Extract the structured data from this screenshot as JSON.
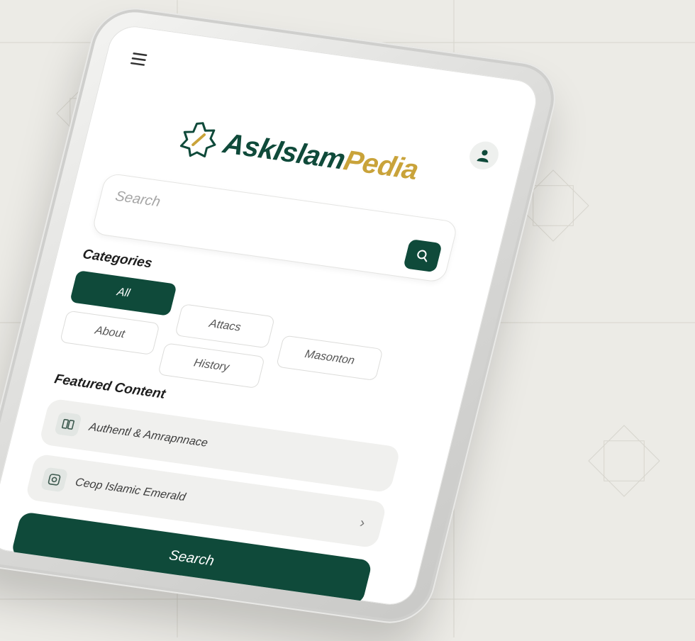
{
  "app": {
    "brand_part1": "AskIslam",
    "brand_part2": "Pedia"
  },
  "search": {
    "placeholder": "Search",
    "button_icon": "search-icon"
  },
  "categories": {
    "title": "Categories",
    "items": [
      {
        "label": "All",
        "active": true
      },
      {
        "label": "Attacs",
        "active": false
      },
      {
        "label": "Masonton",
        "active": false
      },
      {
        "label": "About",
        "active": false
      },
      {
        "label": "History",
        "active": false
      }
    ]
  },
  "featured": {
    "title": "Featured Content",
    "items": [
      {
        "label": "Authentl & Amrapnnace",
        "icon": "book-icon"
      },
      {
        "label": "Ceop Islamic Emerald",
        "icon": "image-icon"
      }
    ]
  },
  "cta": {
    "label": "Search"
  },
  "icons": [
    "menu-icon",
    "user-icon",
    "search-icon",
    "book-icon",
    "image-icon",
    "chevron-right-icon",
    "star-logo-icon"
  ],
  "colors": {
    "primary": "#0f4a3a",
    "gold": "#c9a33a",
    "background": "#ecebe6"
  }
}
